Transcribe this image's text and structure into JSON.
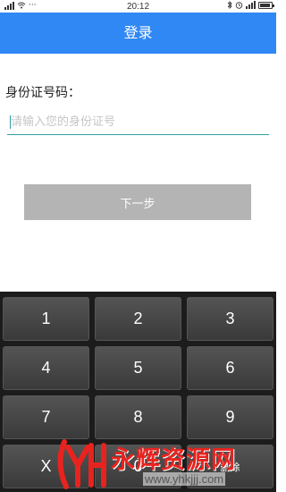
{
  "status_bar": {
    "time": "20:12"
  },
  "header": {
    "title": "登录"
  },
  "form": {
    "id_label": "身份证号码：",
    "id_placeholder": "请输入您的身份证号",
    "id_value": "",
    "next_button": "下一步"
  },
  "keypad": {
    "keys": [
      "1",
      "2",
      "3",
      "4",
      "5",
      "6",
      "7",
      "8",
      "9",
      "X",
      "0",
      "删除"
    ]
  },
  "watermark": {
    "brand": "永辉资源网",
    "url": "www.yhkjjj.com"
  },
  "colors": {
    "accent": "#2f88f4",
    "input_underline": "#2f9ea0",
    "button_disabled": "#b4b4b4",
    "keypad_bg": "#1c1c1c",
    "watermark": "#e8231f"
  }
}
